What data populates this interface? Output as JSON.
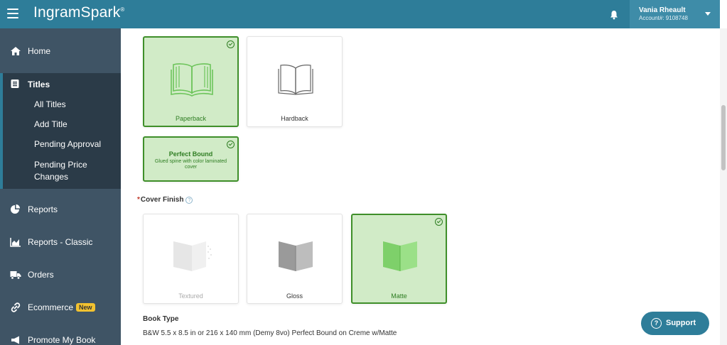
{
  "header": {
    "logo": "IngramSpark",
    "logo_mark": "®",
    "user_name": "Vania Rheault",
    "account": "Account#: 9108748"
  },
  "sidebar": {
    "home": "Home",
    "titles": "Titles",
    "titles_sub": [
      "All Titles",
      "Add Title",
      "Pending Approval",
      "Pending Price Changes"
    ],
    "reports": "Reports",
    "reports_classic": "Reports - Classic",
    "orders": "Orders",
    "ecommerce": "Ecommerce",
    "ecommerce_badge": "New",
    "promote": "Promote My Book"
  },
  "format": {
    "paperback": "Paperback",
    "hardback": "Hardback",
    "selected": "Paperback"
  },
  "binding": {
    "title": "Perfect Bound",
    "desc": "Glued spine with color laminated cover"
  },
  "cover_finish": {
    "label": "Cover Finish",
    "help": "?",
    "options": [
      "Textured",
      "Gloss",
      "Matte"
    ],
    "selected": "Matte"
  },
  "book_type": {
    "label": "Book Type",
    "value": "B&W 5.5 x 8.5 in or 216 x 140 mm (Demy 8vo) Perfect Bound on Creme w/Matte"
  },
  "support": {
    "label": "Support",
    "icon": "?"
  },
  "colors": {
    "header": "#2e7d99",
    "sidebar": "#3f5465",
    "selected_bg": "#d1ebc7",
    "selected_border": "#3f8f2a",
    "badge": "#f2c230"
  }
}
